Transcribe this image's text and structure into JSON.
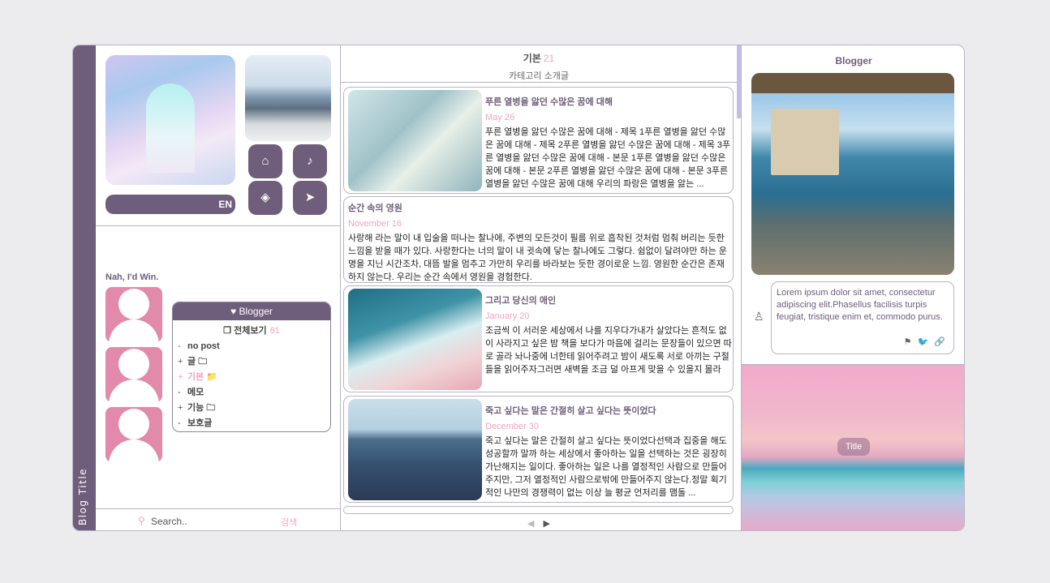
{
  "blog_title": "Blog Title",
  "sidebar": {
    "lang_label": "EN",
    "icons": [
      "home-icon",
      "bell-icon",
      "tag-icon",
      "paper-plane-icon"
    ],
    "tagline": "Nah, I'd Win.",
    "category_box": {
      "header": "Blogger",
      "all_label": "전체보기",
      "all_count": "81",
      "items": [
        {
          "prefix": "-",
          "label": "no post",
          "icon": ""
        },
        {
          "prefix": "+",
          "label": "글",
          "icon": "🗀"
        },
        {
          "prefix": "+",
          "label": "기본",
          "icon": "📁"
        },
        {
          "prefix": "-",
          "label": "메모",
          "icon": ""
        },
        {
          "prefix": "+",
          "label": "기능",
          "icon": "🗀"
        },
        {
          "prefix": "-",
          "label": "보호글",
          "icon": ""
        }
      ]
    },
    "search": {
      "placeholder": "Search..",
      "button": "검색"
    }
  },
  "feed": {
    "category_title": "기본",
    "category_count": "21",
    "category_desc": "카테고리 소개글",
    "posts": [
      {
        "title": "푸른 열병을 앓던 수많은 꿈에 대해",
        "date": "May 26",
        "excerpt": "푸른 열병을 앓던 수많은 꿈에 대해 - 제목 1푸른 열병을 앓던 수많은 꿈에 대해 - 제목 2푸른 열병을 앓던 수많은 꿈에 대해 - 제목 3푸른 열병을 앓던 수많은 꿈에 대해 - 본문 1푸른 열병을 앓던 수많은 꿈에 대해 - 본문 2푸른 열병을 앓던 수많은 꿈에 대해 - 본문 3푸른 열병을 앓던 수많은 꿈에 대해 우리의 파랑은 열병을 앓는 ..."
      },
      {
        "title": "순간 속의 영원",
        "date": "November 16",
        "excerpt": "사랑해 라는 말이 내 입술을 떠나는 찰나에, 주변의 모든것이 필름 위로 흡착된 것처럼 멈춰 버리는 듯한 느낌을 받을 때가 있다. 사랑한다는 너의 말이 내 귓속에 닿는 찰나에도 그렇다. 쉼없이 달려야만 하는 운명을 지닌 시간조차, 대뜸 발을 멈추고 가만히 우리를 바라보는 듯한 경이로운 느낌. 영원한 순간은 존재하지 않는다. 우리는 순간 속에서 영원을 경험한다."
      },
      {
        "title": "그리고 당신의 애인",
        "date": "January 20",
        "excerpt": "조금씩 이 서러운 세상에서 나를 지우다가내가 살았다는 흔적도 없이 사라지고 싶은 밤 책을 보다가 마음에 걸리는 문장들이 있으면 따로 골라 놔나중에 너한테 읽어주려고 밤이 새도록 서로 아끼는 구절들을 읽어주자그러면 새벽을 조금 덜 아프게 맞을 수 있을지 몰라"
      },
      {
        "title": "죽고 싶다는 말은 간절히 살고 싶다는 뜻이었다",
        "date": "December 30",
        "excerpt": "죽고 싶다는 말은 간절히 살고 싶다는 뜻이었다선택과 집중을 해도 성공할까 말까 하는 세상에서 좋아하는 일을 선택하는 것은 굉장히 가난해지는 일이다. 좋아하는 일은 나를 열정적인 사람으로 만들어주지만, 그저 열정적인 사람으로밖에 만들어주지 않는다.정말 획기적인 나만의 경쟁력이 없는 이상 늘 평균 언저리를 맴돌 ..."
      }
    ],
    "pager": {
      "prev": "◀",
      "next": "▶"
    }
  },
  "right": {
    "title": "Blogger",
    "bio": "Lorem ipsum dolor sit amet, consectetur adipiscing elit.Phasellus facilisis turpis feugiat, tristique enim et, commodo purus.",
    "bio_icons": "⚑ 🐦 🔗",
    "banner_title": "Title"
  }
}
